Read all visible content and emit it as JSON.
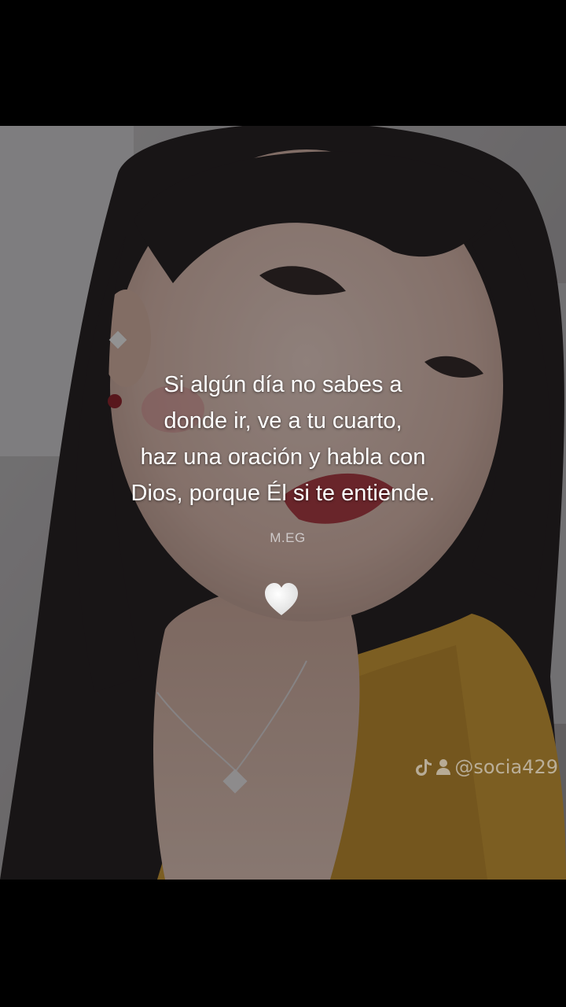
{
  "post": {
    "quote_lines": [
      "Si algún día no sabes a",
      "donde ir, ve a tu cuarto,",
      "haz una oración y habla con",
      "Dios, porque Él si te entiende."
    ],
    "signature": "M.EG",
    "emoji": "white-heart-icon"
  },
  "watermark": {
    "platform_icon": "tiktok-logo-icon",
    "profile_icon": "person-icon",
    "handle": "@socia429"
  },
  "colors": {
    "text": "#ffffff",
    "letterbox": "#000000",
    "sweater": "#c8942e",
    "lips": "#a8323c"
  }
}
